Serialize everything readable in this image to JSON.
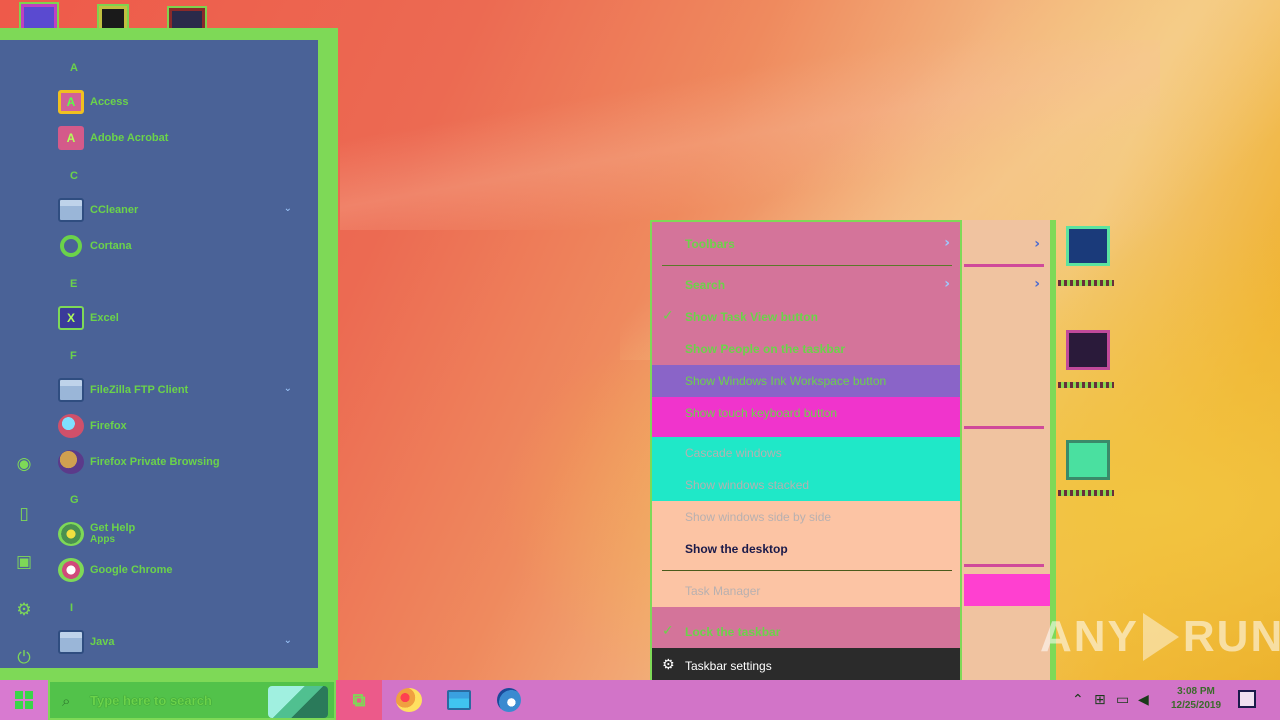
{
  "start_menu": {
    "groups": [
      {
        "letter": "A",
        "apps": [
          {
            "label": "Access",
            "icon": "access-icon"
          },
          {
            "label": "Adobe Acrobat",
            "icon": "adobe-acrobat-icon"
          }
        ]
      },
      {
        "letter": "C",
        "apps": [
          {
            "label": "CCleaner",
            "icon": "folder-icon",
            "expandable": true
          },
          {
            "label": "Cortana",
            "icon": "cortana-icon"
          }
        ]
      },
      {
        "letter": "E",
        "apps": [
          {
            "label": "Excel",
            "icon": "excel-icon"
          }
        ]
      },
      {
        "letter": "F",
        "apps": [
          {
            "label": "FileZilla FTP Client",
            "icon": "folder-icon",
            "expandable": true
          },
          {
            "label": "Firefox",
            "icon": "firefox-icon"
          },
          {
            "label": "Firefox Private Browsing",
            "icon": "firefox-private-icon"
          }
        ]
      },
      {
        "letter": "G",
        "apps": [
          {
            "label": "Get Help",
            "sub": "Apps",
            "icon": "get-help-icon"
          },
          {
            "label": "Google Chrome",
            "icon": "chrome-icon"
          }
        ]
      },
      {
        "letter": "I",
        "apps": [
          {
            "label": "Java",
            "icon": "folder-icon",
            "expandable": true
          }
        ]
      }
    ],
    "rail_icons": [
      "user-avatar-icon",
      "document-icon",
      "pictures-icon",
      "settings-icon",
      "power-icon"
    ]
  },
  "context_menu": {
    "items": [
      {
        "label": "Toolbars",
        "submenu": true,
        "checked": false,
        "state": "normal"
      },
      {
        "label": "Search",
        "submenu": true,
        "checked": false,
        "state": "normal"
      },
      {
        "label": "Show Task View button",
        "submenu": false,
        "checked": true,
        "state": "normal"
      },
      {
        "label": "Show People on the taskbar",
        "submenu": false,
        "checked": false,
        "state": "normal"
      },
      {
        "label": "Show Windows Ink Workspace button",
        "submenu": false,
        "checked": false,
        "state": "highlight"
      },
      {
        "label": "Show touch keyboard button",
        "submenu": false,
        "checked": false,
        "state": "highlight"
      },
      {
        "label": "Cascade windows",
        "submenu": false,
        "checked": false,
        "state": "disabled"
      },
      {
        "label": "Show windows stacked",
        "submenu": false,
        "checked": false,
        "state": "disabled"
      },
      {
        "label": "Show windows side by side",
        "submenu": false,
        "checked": false,
        "state": "disabled"
      },
      {
        "label": "Show the desktop",
        "submenu": false,
        "checked": false,
        "state": "normal"
      },
      {
        "label": "Task Manager",
        "submenu": false,
        "checked": false,
        "state": "disabled"
      },
      {
        "label": "Lock the taskbar",
        "submenu": false,
        "checked": true,
        "state": "normal"
      },
      {
        "label": "Taskbar settings",
        "submenu": false,
        "checked": false,
        "state": "selected",
        "icon": "gear-icon"
      }
    ]
  },
  "taskbar": {
    "search_placeholder": "Type here to search",
    "pinned": [
      "task-view-icon",
      "paint-icon",
      "file-explorer-icon",
      "edge-icon"
    ],
    "clock_time": "3:08 PM",
    "clock_date": "12/25/2019"
  },
  "watermark": {
    "left": "ANY",
    "right": "RUN"
  },
  "colors": {
    "start_bg": "#4a6297",
    "accent_green": "#7ed957",
    "taskbar_bg": "#d274c8",
    "menu_bg": "#d4749a",
    "selected_bg": "#2b2b2b"
  }
}
